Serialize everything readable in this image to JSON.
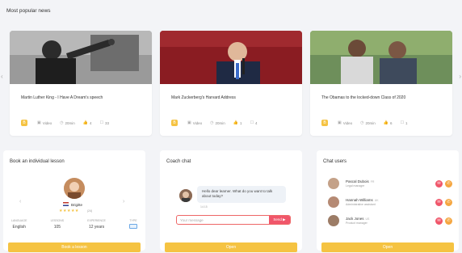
{
  "page": {
    "title": "Most popular news"
  },
  "nav": {
    "prev_icon": "chevron-left-icon",
    "next_icon": "chevron-right-icon"
  },
  "news": [
    {
      "caption": "Martin Luther King - I Have A Dream's speech",
      "level": "B",
      "video": "Video",
      "duration": "20min",
      "likes": "4",
      "comments": "33",
      "liked": true
    },
    {
      "caption": "Mark Zuckerberg's Harvard Address",
      "level": "B",
      "video": "Video",
      "duration": "20min",
      "likes": "1",
      "comments": "4",
      "liked": false
    },
    {
      "caption": "The Obamas to the locked-down Class of 2020",
      "level": "B",
      "video": "Video",
      "duration": "20min",
      "likes": "6",
      "comments": "1",
      "liked": true
    }
  ],
  "lesson": {
    "title": "Book an individual lesson",
    "teacher_name": "Brigitte",
    "stars": "★★★★★",
    "reviews": "(24)",
    "stats": [
      {
        "label": "Language",
        "value": "English"
      },
      {
        "label": "Lessons",
        "value": "105"
      },
      {
        "label": "Experience",
        "value": "12 years"
      },
      {
        "label": "Type",
        "value": ""
      }
    ],
    "button": "Book a lesson"
  },
  "coach": {
    "title": "Coach chat",
    "message": "Hello dear learner. What do you want to talk about today?",
    "time": "14:15",
    "input_placeholder": "Your message",
    "send_label": "Send ▶",
    "button": "Open"
  },
  "chat_users": {
    "title": "Chat users",
    "users": [
      {
        "name": "Pascal Dubois",
        "flag": "FR",
        "role": "Legal manager"
      },
      {
        "name": "Hannah Williams",
        "flag": "UK",
        "role": "Administrative assistant"
      },
      {
        "name": "Jack Jones",
        "flag": "US",
        "role": "Product manager"
      }
    ],
    "button": "Open"
  },
  "colors": {
    "accent": "#f5c342",
    "danger": "#f0566a",
    "link": "#3a7bd5"
  }
}
